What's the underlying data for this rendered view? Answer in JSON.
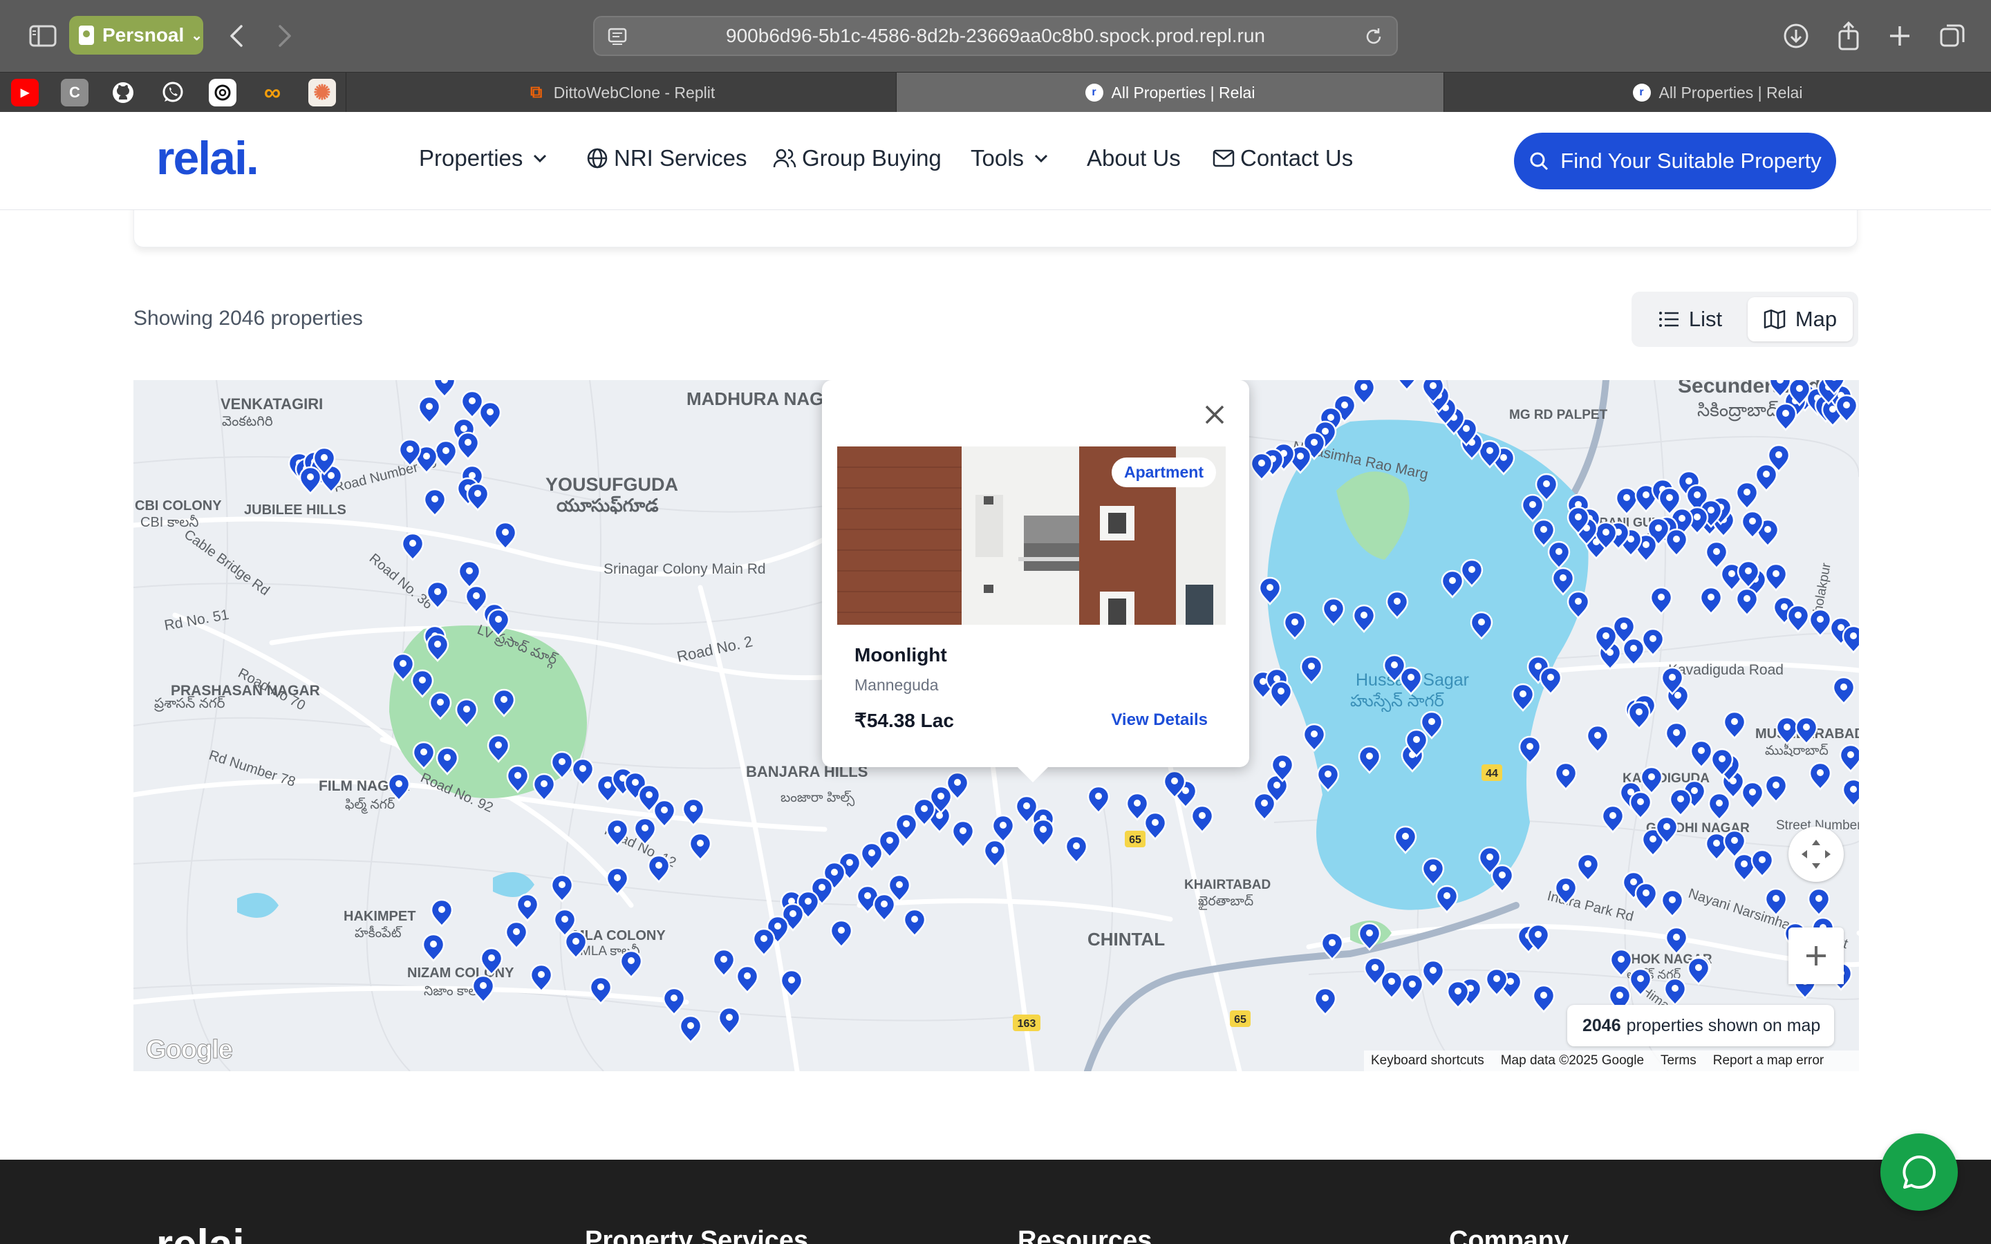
{
  "browser": {
    "profile_label": "Persnoal",
    "url": "900b6d96-5b1c-4586-8d2b-23669aa0c8b0.spock.prod.repl.run",
    "pinned_tabs": [
      {
        "icon": "youtube-icon",
        "letter": "▶",
        "color": "#ff0000"
      },
      {
        "icon": "c-app-icon",
        "letter": "C",
        "color": "#9a9a9a"
      },
      {
        "icon": "github-icon",
        "letter": "",
        "color": "#ffffff"
      },
      {
        "icon": "whatsapp-icon",
        "letter": "",
        "color": "#25d366"
      },
      {
        "icon": "openai-icon",
        "letter": "",
        "color": "#ffffff"
      },
      {
        "icon": "infinity-icon",
        "letter": "∞",
        "color": "#f59e0b"
      },
      {
        "icon": "claude-icon",
        "letter": "✺",
        "color": "#e8734a"
      }
    ],
    "tabs": [
      {
        "title": "DittoWebClone - Replit",
        "active": false
      },
      {
        "title": "All Properties | Relai",
        "active": true
      },
      {
        "title": "All Properties | Relai",
        "active": false
      }
    ]
  },
  "site": {
    "logo": "relai.",
    "nav": {
      "properties": "Properties",
      "nri_services": "NRI Services",
      "group_buying": "Group Buying",
      "tools": "Tools",
      "about_us": "About Us",
      "contact_us": "Contact Us"
    },
    "cta": "Find Your Suitable Property",
    "brand_color": "#1d4ed8"
  },
  "listing": {
    "showing_text": "Showing 2046 properties",
    "view_list": "List",
    "view_map": "Map",
    "active_view": "Map"
  },
  "map": {
    "count_number": "2046",
    "count_suffix": "properties shown on map",
    "google_logo": "Google",
    "footer_links": [
      "Keyboard shortcuts",
      "Map data ©2025 Google",
      "Terms",
      "Report a map error"
    ],
    "labels": [
      "VENKATAGIRI",
      "వెంకటగిరి",
      "YOUSUFGUDA",
      "యూసుఫ్‌గూడ",
      "MADHURA NAGAR",
      "CBI COLONY",
      "CBI కాలనీ",
      "JUBILEE HILLS",
      "Road Number 10",
      "Cable Bridge Rd",
      "Road No. 36",
      "Srinagar Colony Main Rd",
      "Rd No. 51",
      "LV ప్రసాద్ మార్గ్",
      "Road No. 2",
      "PRASHASAN NAGAR",
      "ప్రశాసన్ నగర్",
      "Road No 70",
      "Rd Number 78",
      "FILM NAGAR",
      "ఫిల్మ్ నగర్",
      "Road No. 92",
      "BANJARA HILLS",
      "బంజారా హిల్స్",
      "Road No. 12",
      "HAKIMPET",
      "హకీంపేట్",
      "MLA COLONY",
      "MLA కాలనీ",
      "NIZAM COLONY",
      "నిజాం కాలనీ",
      "KHAIRTABAD",
      "ఖైరతాబాద్",
      "CHINTAL",
      "Hussain Sagar",
      "హుస్సేన్ సాగర్",
      "Secunderabad",
      "సికింద్రాబాద్",
      "MG RD PALPET",
      "Narasimha Rao Marg",
      "KAVADIGUDA",
      "Kavadiguda Road",
      "MUSHEERABAD",
      "ముషీరాబాద్",
      "GANDHI NAGAR",
      "ASHOK NAGAR",
      "అశోక్ నగర్",
      "Indira Park Rd",
      "Nayani Narsimha Reddy St",
      "Himayat Nagar",
      "Street Number",
      "Bholakpur",
      "RANI GUNJ",
      "రాణి గంజ్",
      "44",
      "65",
      "163",
      "65"
    ],
    "pin_color": "#1d4ed8",
    "water_color": "#8dd6ef",
    "park_color": "#a7dfb0"
  },
  "popup": {
    "badge": "Apartment",
    "title": "Moonlight",
    "location": "Manneguda",
    "price": "₹54.38 Lac",
    "link": "View Details"
  },
  "footer": {
    "logo": "relai.",
    "headings": [
      "Property Services",
      "Resources",
      "Company"
    ]
  }
}
